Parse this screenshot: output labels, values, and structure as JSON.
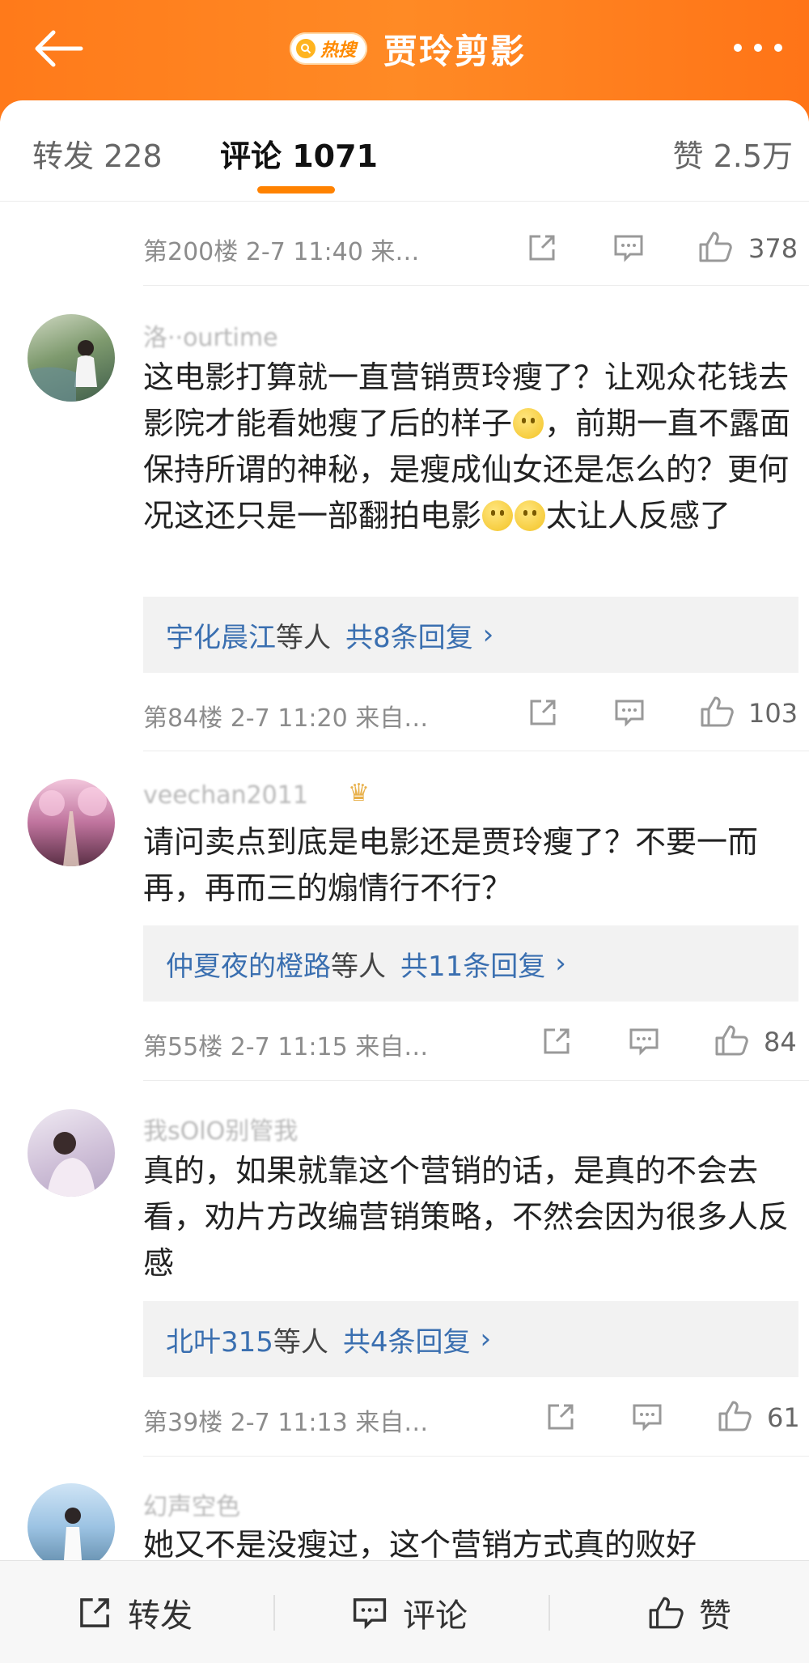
{
  "header": {
    "hot_label": "热搜",
    "title": "贾玲剪影"
  },
  "tabs": {
    "repost": "转发 228",
    "comment": "评论 1071",
    "like": "赞 2.5万"
  },
  "top_row": {
    "meta": "第200楼  2-7 11:40  来…",
    "likes": "378"
  },
  "comments": [
    {
      "username": "洛··ourtime",
      "text": "这电影打算就一直营销贾玲瘦了？让观众花钱去影院才能看她瘦了后的样子",
      "text2": "，前期一直不露面保持所谓的神秘，是瘦成仙女还是怎么的？更何况这还只是一部翻拍电影",
      "text3": "太让人反感了",
      "reply_name": "宇化晨江",
      "reply_mid": "等人",
      "reply_count": "共8条回复",
      "meta": "第84楼  2-7 11:20  来自…",
      "likes": "103"
    },
    {
      "username": "veechan2011",
      "text": "请问卖点到底是电影还是贾玲瘦了？不要一而再，再而三的煽情行不行？",
      "reply_name": "仲夏夜的橙路",
      "reply_mid": "等人",
      "reply_count": "共11条回复",
      "meta": "第55楼  2-7 11:15  来自…",
      "likes": "84"
    },
    {
      "username": "我sOlO别管我",
      "text": "真的，如果就靠这个营销的话，是真的不会去看，劝片方改编营销策略，不然会因为很多人反感",
      "reply_name": "北叶315",
      "reply_mid": "等人",
      "reply_count": "共4条回复",
      "meta": "第39楼  2-7 11:13  来自…",
      "likes": "61"
    },
    {
      "username": "幻声空色",
      "text": "她又不是没瘦过，这个营销方式真的败好"
    }
  ],
  "bottom_bar": {
    "repost": "转发",
    "comment": "评论",
    "like": "赞"
  },
  "colors": {
    "header": "#ff7a1a",
    "accent_underline": "#ff8200",
    "link_blue": "#3a6fb0"
  }
}
